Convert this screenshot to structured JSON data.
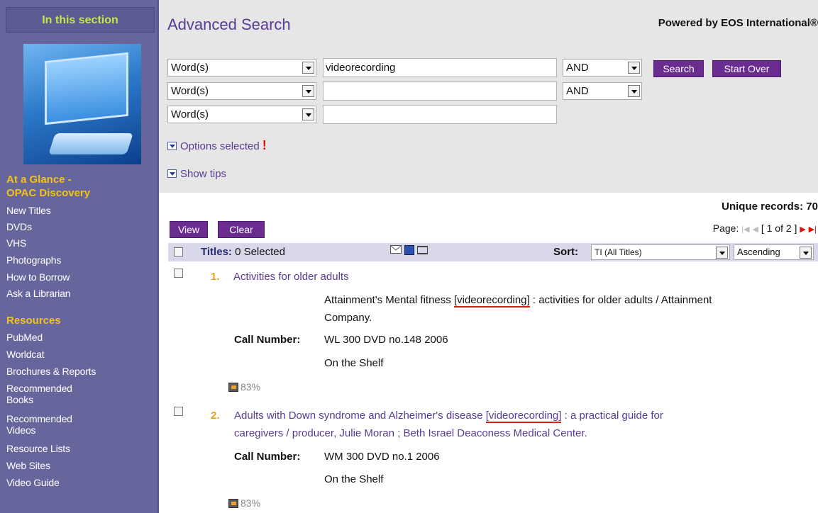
{
  "sidebar": {
    "section_header": "In this section",
    "group1_title_line1": "At a Glance -",
    "group1_title_line2": "OPAC Discovery",
    "group1_items": [
      "New Titles",
      "DVDs",
      "VHS",
      "Photographs",
      "How to Borrow",
      "Ask a Librarian"
    ],
    "group2_title": "Resources",
    "group2_items": [
      "PubMed",
      "Worldcat",
      "Brochures & Reports",
      "Recommended",
      "Books",
      "Recommended",
      "Videos",
      "Resource Lists",
      "Web Sites",
      "Video Guide"
    ]
  },
  "search": {
    "title": "Advanced Search",
    "powered_by": "Powered by EOS International®",
    "rows": [
      {
        "field": "Word(s)",
        "value": "videorecording",
        "operator": "AND"
      },
      {
        "field": "Word(s)",
        "value": "",
        "operator": "AND"
      },
      {
        "field": "Word(s)",
        "value": ""
      }
    ],
    "search_button": "Search",
    "start_over_button": "Start Over",
    "options_label": "Options selected",
    "options_flag": "!",
    "tips_label": "Show tips"
  },
  "results": {
    "unique_records": "Unique records: 70",
    "view_button": "View",
    "clear_button": "Clear",
    "page_label": "Page:",
    "page_value": "[ 1 of 2 ]",
    "titles_label": "Titles:",
    "selected_text": "0  Selected",
    "sort_label": "Sort:",
    "sort_value": "TI (All Titles)",
    "order_value": "Ascending",
    "items": [
      {
        "number": "1.",
        "title": "Activities for older adults",
        "desc_pre": "Attainment's Mental fitness ",
        "desc_hl": "[videorecording]",
        "desc_post": " : activities for older adults / Attainment",
        "desc_line2": "Company.",
        "call_label": "Call Number:",
        "call_number": "WL 300 DVD no.148 2006",
        "status": "On the Shelf",
        "relevance": "83%"
      },
      {
        "number": "2.",
        "title_pre": "Adults with Down syndrome and Alzheimer's disease ",
        "title_hl": "[videorecording]",
        "title_post": " : a practical guide for",
        "title_line2": "caregivers / producer, Julie Moran ; Beth Israel Deaconess Medical Center.",
        "call_label": "Call Number:",
        "call_number": "WM 300 DVD no.1 2006",
        "status": "On the Shelf",
        "relevance": "83%"
      }
    ]
  },
  "colors": {
    "sidebar_bg": "#66669c",
    "accent_purple": "#6b2c90",
    "link_purple": "#5a3b93",
    "highlight_red": "#d81b1b",
    "number_orange": "#e8a020"
  }
}
